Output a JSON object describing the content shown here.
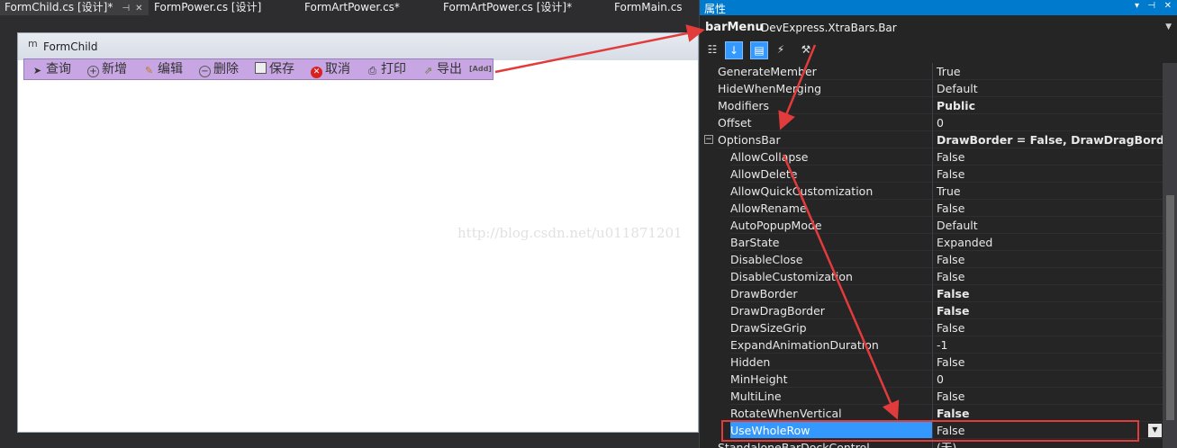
{
  "tabs": [
    {
      "label": "FormChild.cs [设计]*",
      "active": true
    },
    {
      "label": "FormPower.cs [设计]"
    },
    {
      "label": "FormArtPower.cs*"
    },
    {
      "label": "FormArtPower.cs [设计]*"
    },
    {
      "label": "FormMain.cs"
    }
  ],
  "form": {
    "icon": "form-icon",
    "title": "FormChild",
    "bar_items": [
      {
        "label": "查询",
        "icon": "pointer-icon"
      },
      {
        "label": "新增",
        "icon": "add-icon"
      },
      {
        "label": "编辑",
        "icon": "edit-icon"
      },
      {
        "label": "删除",
        "icon": "remove-icon"
      },
      {
        "label": "保存",
        "icon": "save-icon"
      },
      {
        "label": "取消",
        "icon": "cancel-icon"
      },
      {
        "label": "打印",
        "icon": "print-icon"
      },
      {
        "label": "导出",
        "icon": "export-icon"
      }
    ],
    "bar_add_label": "[Add]"
  },
  "properties": {
    "header_title": "属性",
    "object_name": "barMenu",
    "object_type": "DevExpress.XtraBars.Bar",
    "rows": [
      {
        "name": "GenerateMember",
        "value": "True"
      },
      {
        "name": "HideWhenMerging",
        "value": "Default"
      },
      {
        "name": "Modifiers",
        "value": "Public",
        "bold": true
      },
      {
        "name": "Offset",
        "value": "0"
      },
      {
        "name": "OptionsBar",
        "value": "DrawBorder = False, DrawDragBorder = F",
        "bold": true,
        "expander": "⊟"
      },
      {
        "name": "AllowCollapse",
        "value": "False",
        "child": true
      },
      {
        "name": "AllowDelete",
        "value": "False",
        "child": true
      },
      {
        "name": "AllowQuickCustomization",
        "value": "True",
        "child": true
      },
      {
        "name": "AllowRename",
        "value": "False",
        "child": true
      },
      {
        "name": "AutoPopupMode",
        "value": "Default",
        "child": true
      },
      {
        "name": "BarState",
        "value": "Expanded",
        "child": true
      },
      {
        "name": "DisableClose",
        "value": "False",
        "child": true
      },
      {
        "name": "DisableCustomization",
        "value": "False",
        "child": true
      },
      {
        "name": "DrawBorder",
        "value": "False",
        "child": true,
        "bold": true
      },
      {
        "name": "DrawDragBorder",
        "value": "False",
        "child": true,
        "bold": true
      },
      {
        "name": "DrawSizeGrip",
        "value": "False",
        "child": true
      },
      {
        "name": "ExpandAnimationDuration",
        "value": "-1",
        "child": true
      },
      {
        "name": "Hidden",
        "value": "False",
        "child": true
      },
      {
        "name": "MinHeight",
        "value": "0",
        "child": true
      },
      {
        "name": "MultiLine",
        "value": "False",
        "child": true
      },
      {
        "name": "RotateWhenVertical",
        "value": "False",
        "child": true,
        "bold": true
      },
      {
        "name": "UseWholeRow",
        "value": "False",
        "child": true,
        "selected": true
      },
      {
        "name": "StandaloneBarDockControl",
        "value": "(无)"
      }
    ]
  },
  "watermark": "http://blog.csdn.net/u011871201",
  "colors": {
    "accent": "#007acc",
    "annotation": "#e23b3b",
    "bar_bg": "#c7a6e3"
  }
}
